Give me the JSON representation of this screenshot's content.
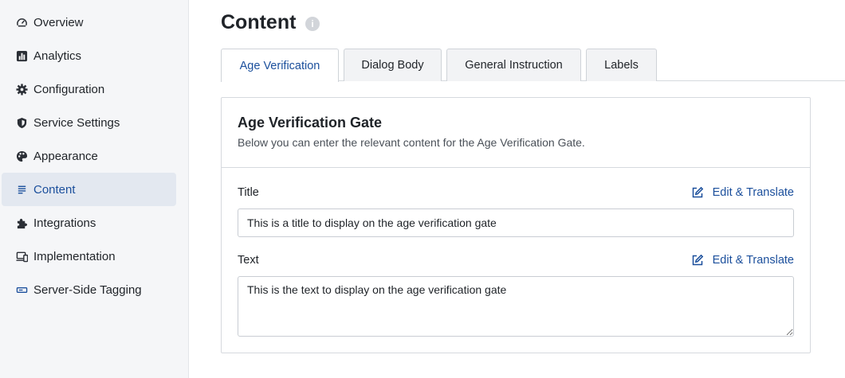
{
  "sidebar": {
    "items": [
      {
        "label": "Overview",
        "icon": "gauge-icon"
      },
      {
        "label": "Analytics",
        "icon": "bar-chart-icon"
      },
      {
        "label": "Configuration",
        "icon": "gear-icon"
      },
      {
        "label": "Service Settings",
        "icon": "shield-icon"
      },
      {
        "label": "Appearance",
        "icon": "palette-icon"
      },
      {
        "label": "Content",
        "icon": "lines-icon",
        "active": true
      },
      {
        "label": "Integrations",
        "icon": "puzzle-icon"
      },
      {
        "label": "Implementation",
        "icon": "devices-icon"
      },
      {
        "label": "Server-Side Tagging",
        "icon": "server-icon"
      }
    ]
  },
  "page": {
    "title": "Content",
    "info_icon": "i"
  },
  "tabs": [
    {
      "label": "Age Verification",
      "active": true
    },
    {
      "label": "Dialog Body"
    },
    {
      "label": "General Instruction"
    },
    {
      "label": "Labels"
    }
  ],
  "card": {
    "title": "Age Verification Gate",
    "subtitle": "Below you can enter the relevant content for the Age Verification Gate.",
    "fields": [
      {
        "label": "Title",
        "action": "Edit & Translate",
        "value": "This is a title to display on the age verification gate"
      },
      {
        "label": "Text",
        "action": "Edit & Translate",
        "value": "This is the text to display on the age verification gate"
      }
    ]
  },
  "colors": {
    "accent": "#1b4f9c",
    "sidebar_bg": "#f5f6f8",
    "active_item_bg": "#e3e8f0",
    "border": "#d6d9de"
  }
}
